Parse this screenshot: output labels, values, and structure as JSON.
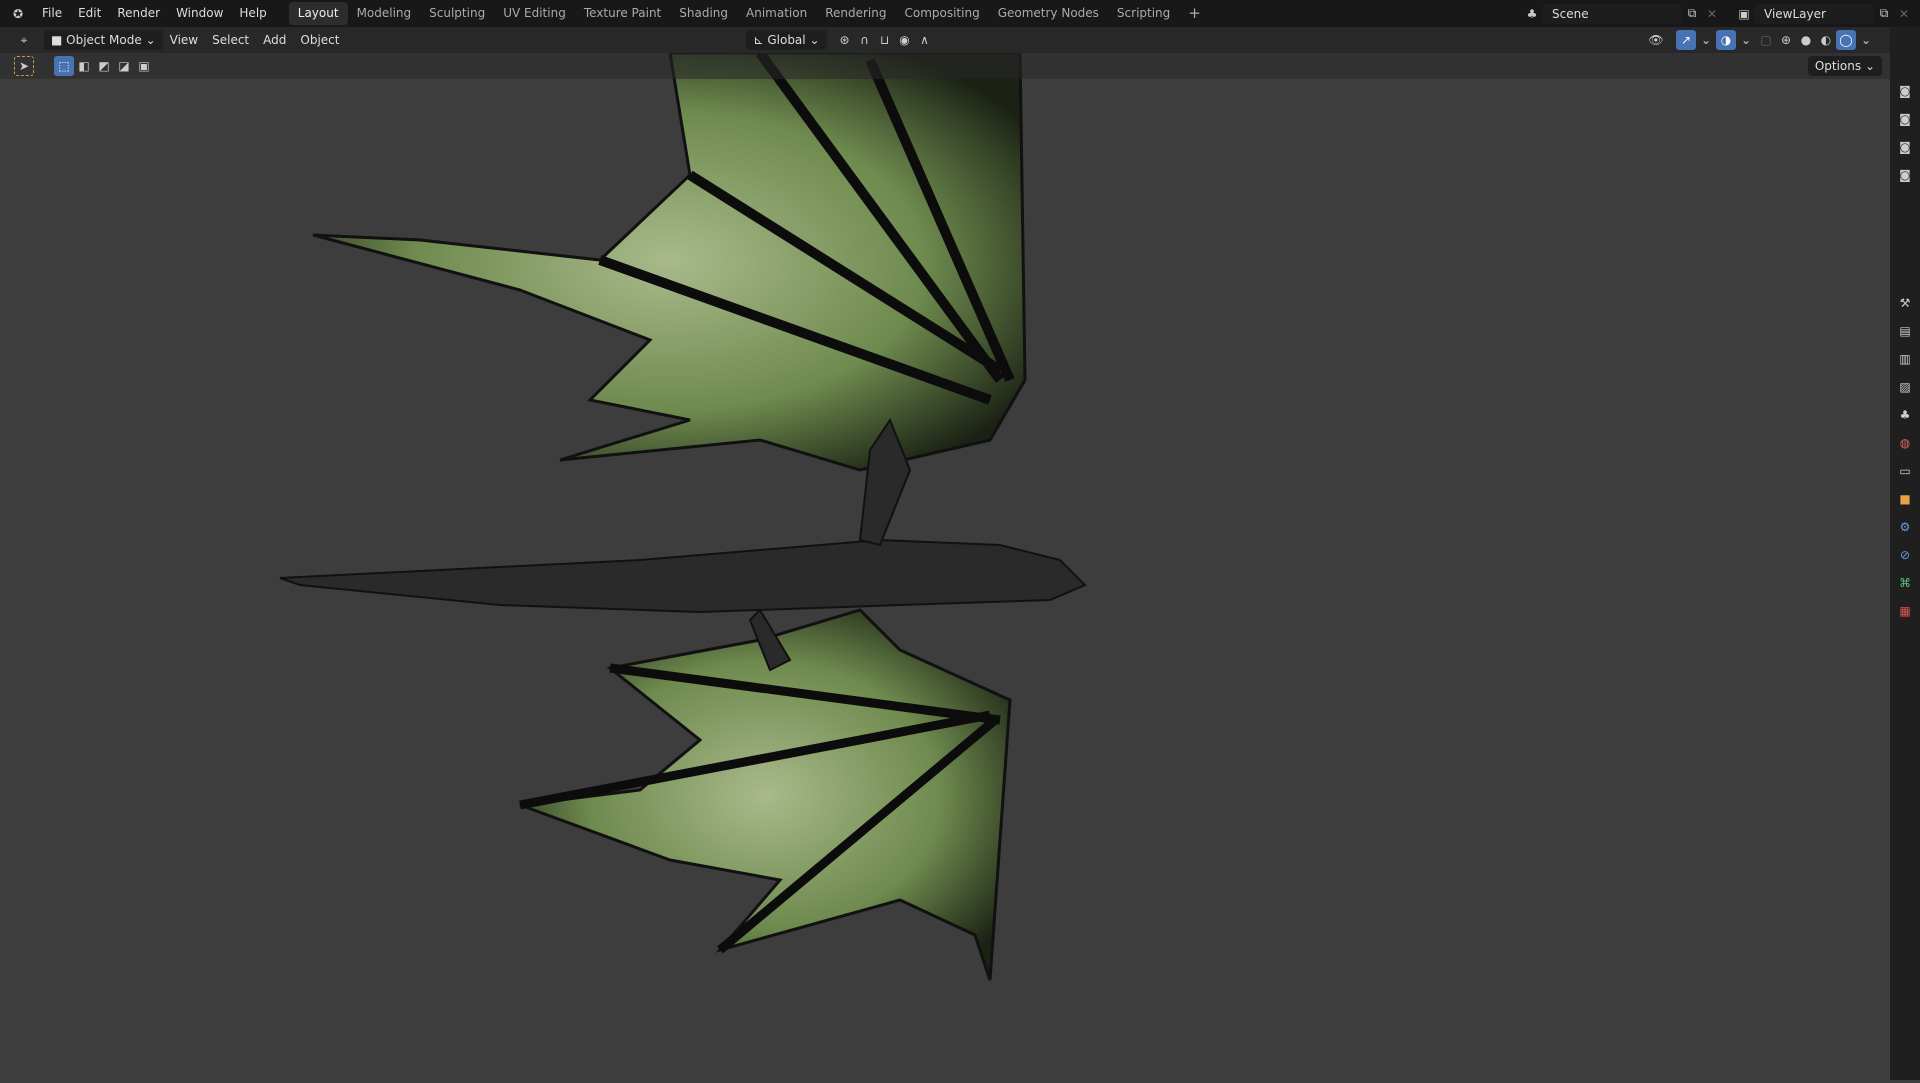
{
  "menu": [
    "File",
    "Edit",
    "Render",
    "Window",
    "Help"
  ],
  "workspaces": [
    "Layout",
    "Modeling",
    "Sculpting",
    "UV Editing",
    "Texture Paint",
    "Shading",
    "Animation",
    "Rendering",
    "Compositing",
    "Geometry Nodes",
    "Scripting"
  ],
  "add_workspace": "+",
  "scene": "Scene",
  "view_layer": "ViewLayer",
  "header": {
    "mode": "Object Mode",
    "view": "View",
    "select": "Select",
    "add": "Add",
    "object": "Object",
    "orientation": "Global",
    "options": "Options"
  },
  "colors": {
    "accent": "#4772b3",
    "viewport": "#3d3d3d"
  }
}
